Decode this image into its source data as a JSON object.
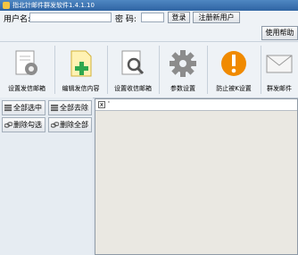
{
  "window": {
    "title": "指北针邮件群发软件1.4.1.10"
  },
  "login": {
    "username_label": "用户名:",
    "username_value": "",
    "password_label": "密  码:",
    "password_value": "",
    "login_button": "登录",
    "register_button": "注册新用户"
  },
  "help_button": "使用帮助",
  "toolbar": {
    "items": [
      {
        "label": "设置发信邮箱",
        "icon": "mailbox-gear-icon"
      },
      {
        "label": "编辑发信内容",
        "icon": "document-plus-icon"
      },
      {
        "label": "设置收信邮箱",
        "icon": "document-search-icon"
      },
      {
        "label": "参数设置",
        "icon": "gear-icon"
      },
      {
        "label": "防止被K设置",
        "icon": "warning-icon"
      },
      {
        "label": "群发邮件",
        "icon": "envelope-icon"
      }
    ]
  },
  "left_panel": {
    "select_all": "全部选中",
    "clear_all": "全部去除",
    "delete_checked": "删除勾选",
    "delete_all": "删除全部"
  },
  "editor": {
    "tab_close": "x",
    "tab_label": "'"
  },
  "colors": {
    "titlebar": "#2f64a3",
    "warning_orange": "#f08a00",
    "gear_gray": "#8c8c8c",
    "add_green": "#2fa84f"
  }
}
